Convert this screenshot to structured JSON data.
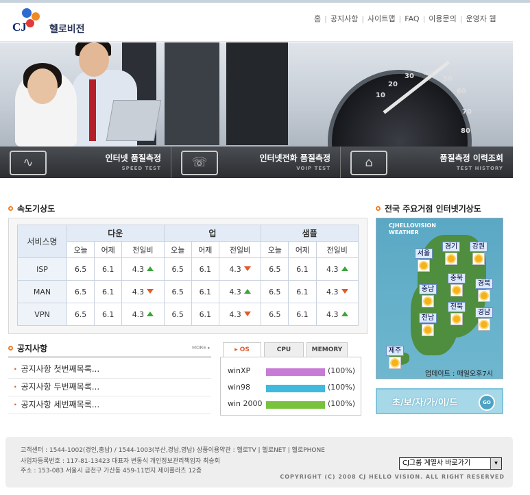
{
  "header": {
    "logo_mark": "CJ",
    "logo_name": "헬로비전",
    "nav": [
      "홈",
      "공지사항",
      "사이트맵",
      "FAQ",
      "이용문의",
      "운영자 웹"
    ]
  },
  "hero": {
    "gauge_numbers": [
      "10",
      "20",
      "30",
      "40",
      "50",
      "60",
      "70",
      "80"
    ]
  },
  "menu": [
    {
      "title": "인터넷 품질측정",
      "sub": "SPEED TEST",
      "icon": "speed-test-icon"
    },
    {
      "title": "인터넷전화 품질측정",
      "sub": "VOIP TEST",
      "icon": "voip-test-icon"
    },
    {
      "title": "품질측정 이력조회",
      "sub": "TEST HISTORY",
      "icon": "test-history-icon"
    }
  ],
  "speed": {
    "title": "속도기상도",
    "service_header": "서비스명",
    "groups": [
      "다운",
      "업",
      "샘플"
    ],
    "subcols": [
      "오늘",
      "어제",
      "전일비"
    ],
    "rows": [
      {
        "name": "ISP",
        "cells": [
          [
            "6.5",
            "6.1",
            "4.3",
            "up"
          ],
          [
            "6.5",
            "6.1",
            "4.3",
            "down"
          ],
          [
            "6.5",
            "6.1",
            "4.3",
            "up"
          ]
        ]
      },
      {
        "name": "MAN",
        "cells": [
          [
            "6.5",
            "6.1",
            "4.3",
            "down"
          ],
          [
            "6.5",
            "6.1",
            "4.3",
            "up"
          ],
          [
            "6.5",
            "6.1",
            "4.3",
            "down"
          ]
        ]
      },
      {
        "name": "VPN",
        "cells": [
          [
            "6.5",
            "6.1",
            "4.3",
            "up"
          ],
          [
            "6.5",
            "6.1",
            "4.3",
            "down"
          ],
          [
            "6.5",
            "6.1",
            "4.3",
            "up"
          ]
        ]
      }
    ]
  },
  "notice": {
    "title": "공지사항",
    "more": "MORE ▸",
    "items": [
      "공지사항 첫번째목록...",
      "공지사항 두번째목록...",
      "공지사항 세번째목록..."
    ]
  },
  "os_panel": {
    "tabs": [
      "▸ OS",
      "CPU",
      "MEMORY"
    ],
    "rows": [
      {
        "name": "winXP",
        "value": 100,
        "label": "(100%)",
        "color": "#c77ad6"
      },
      {
        "name": "win98",
        "value": 100,
        "label": "(100%)",
        "color": "#3fb9de"
      },
      {
        "name": "win 2000",
        "value": 100,
        "label": "(100%)",
        "color": "#79c23d"
      }
    ]
  },
  "weather": {
    "title": "전국 주요거점 인터넷기상도",
    "map_caption": "CJHELLOVISION WEATHER",
    "cities": [
      "서울",
      "경기",
      "강원",
      "충남",
      "충북",
      "경북",
      "전북",
      "경남",
      "전남",
      "제주"
    ],
    "update": "업데이트 : 매일오후7시"
  },
  "guide": {
    "label": "초/보/자/가/이/드",
    "go": "GO"
  },
  "footer": {
    "line1": "고객센터 : 1544-1002(경인,충남) / 1544-1003(부산,경남,영남)      상품이용약관 : 헬로TV  |  헬로NET  |  헬로PHONE",
    "line2": "사업자등록번호 : 117-81-13423  대표자 변동식 개인정보관리책임자 최승회",
    "line3": "주소 : 153-083 서울시 금천구 가산동 459-11번지 제이플라츠 12층",
    "select": "CJ그룹 계열사 바로가기",
    "copyright": "COPYRIGHT (C) 2008 CJ HELLO VISION. ALL RIGHT RESERVED"
  }
}
